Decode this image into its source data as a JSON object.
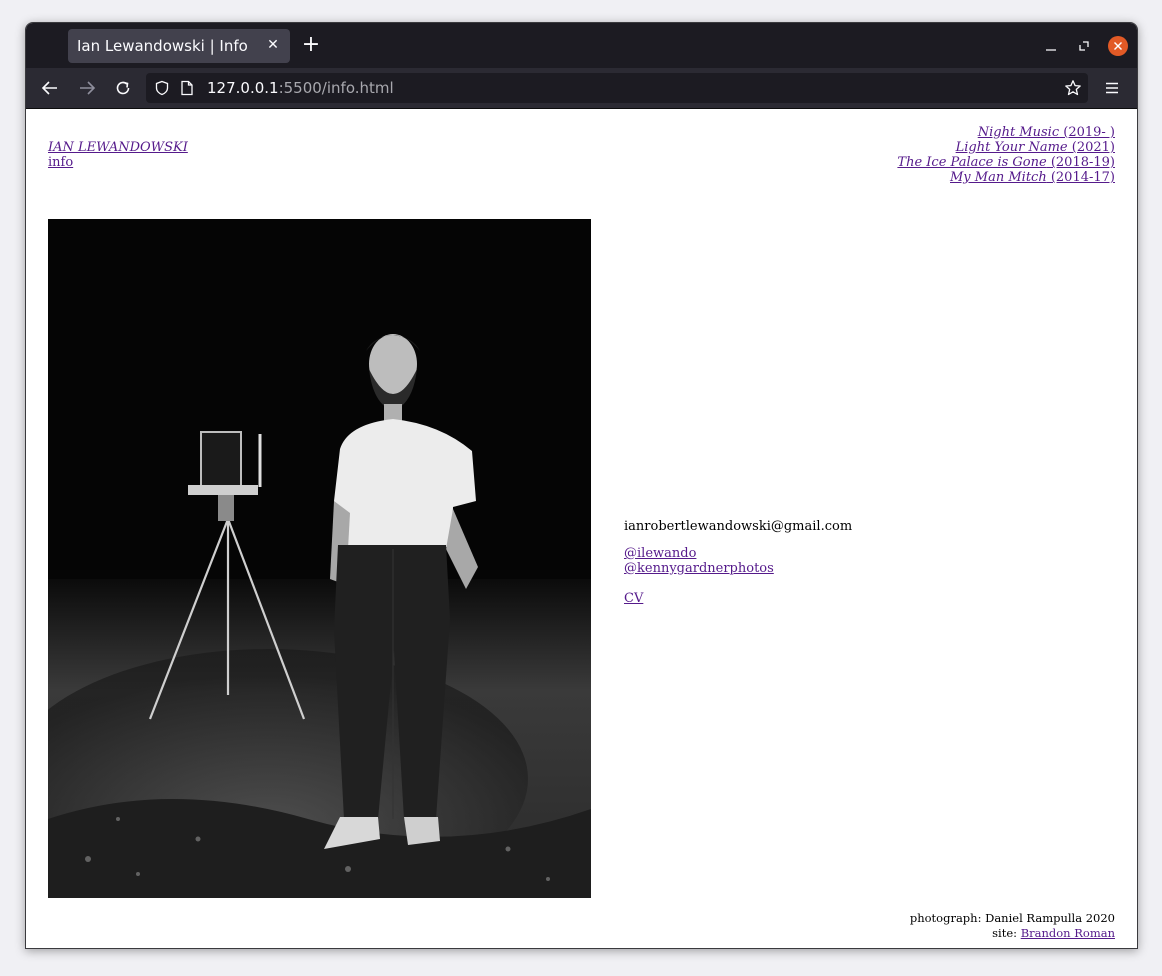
{
  "browser": {
    "tab_title": "Ian Lewandowski | Info",
    "url_host": "127.0.0.1",
    "url_rest": ":5500/info.html",
    "accent_close": "#e25a26"
  },
  "site": {
    "name": "IAN LEWANDOWSKI",
    "info_link": "info",
    "projects": [
      {
        "title": "Night Music",
        "years": " (2019- )"
      },
      {
        "title": "Light Your Name",
        "years": " (2021)"
      },
      {
        "title": "The Ice Palace is Gone",
        "years": " (2018-19)"
      },
      {
        "title": "My Man Mitch",
        "years": " (2014-17)"
      }
    ],
    "contact": {
      "email": "ianrobertlewandowski@gmail.com",
      "social": [
        "@ilewando",
        "@kennygardnerphotos"
      ],
      "cv": "CV"
    },
    "credits": {
      "photograph": "photograph: Daniel Rampulla 2020",
      "site_prefix": "site: ",
      "site_author": "Brandon Roman"
    },
    "link_color": "#551a8b"
  }
}
